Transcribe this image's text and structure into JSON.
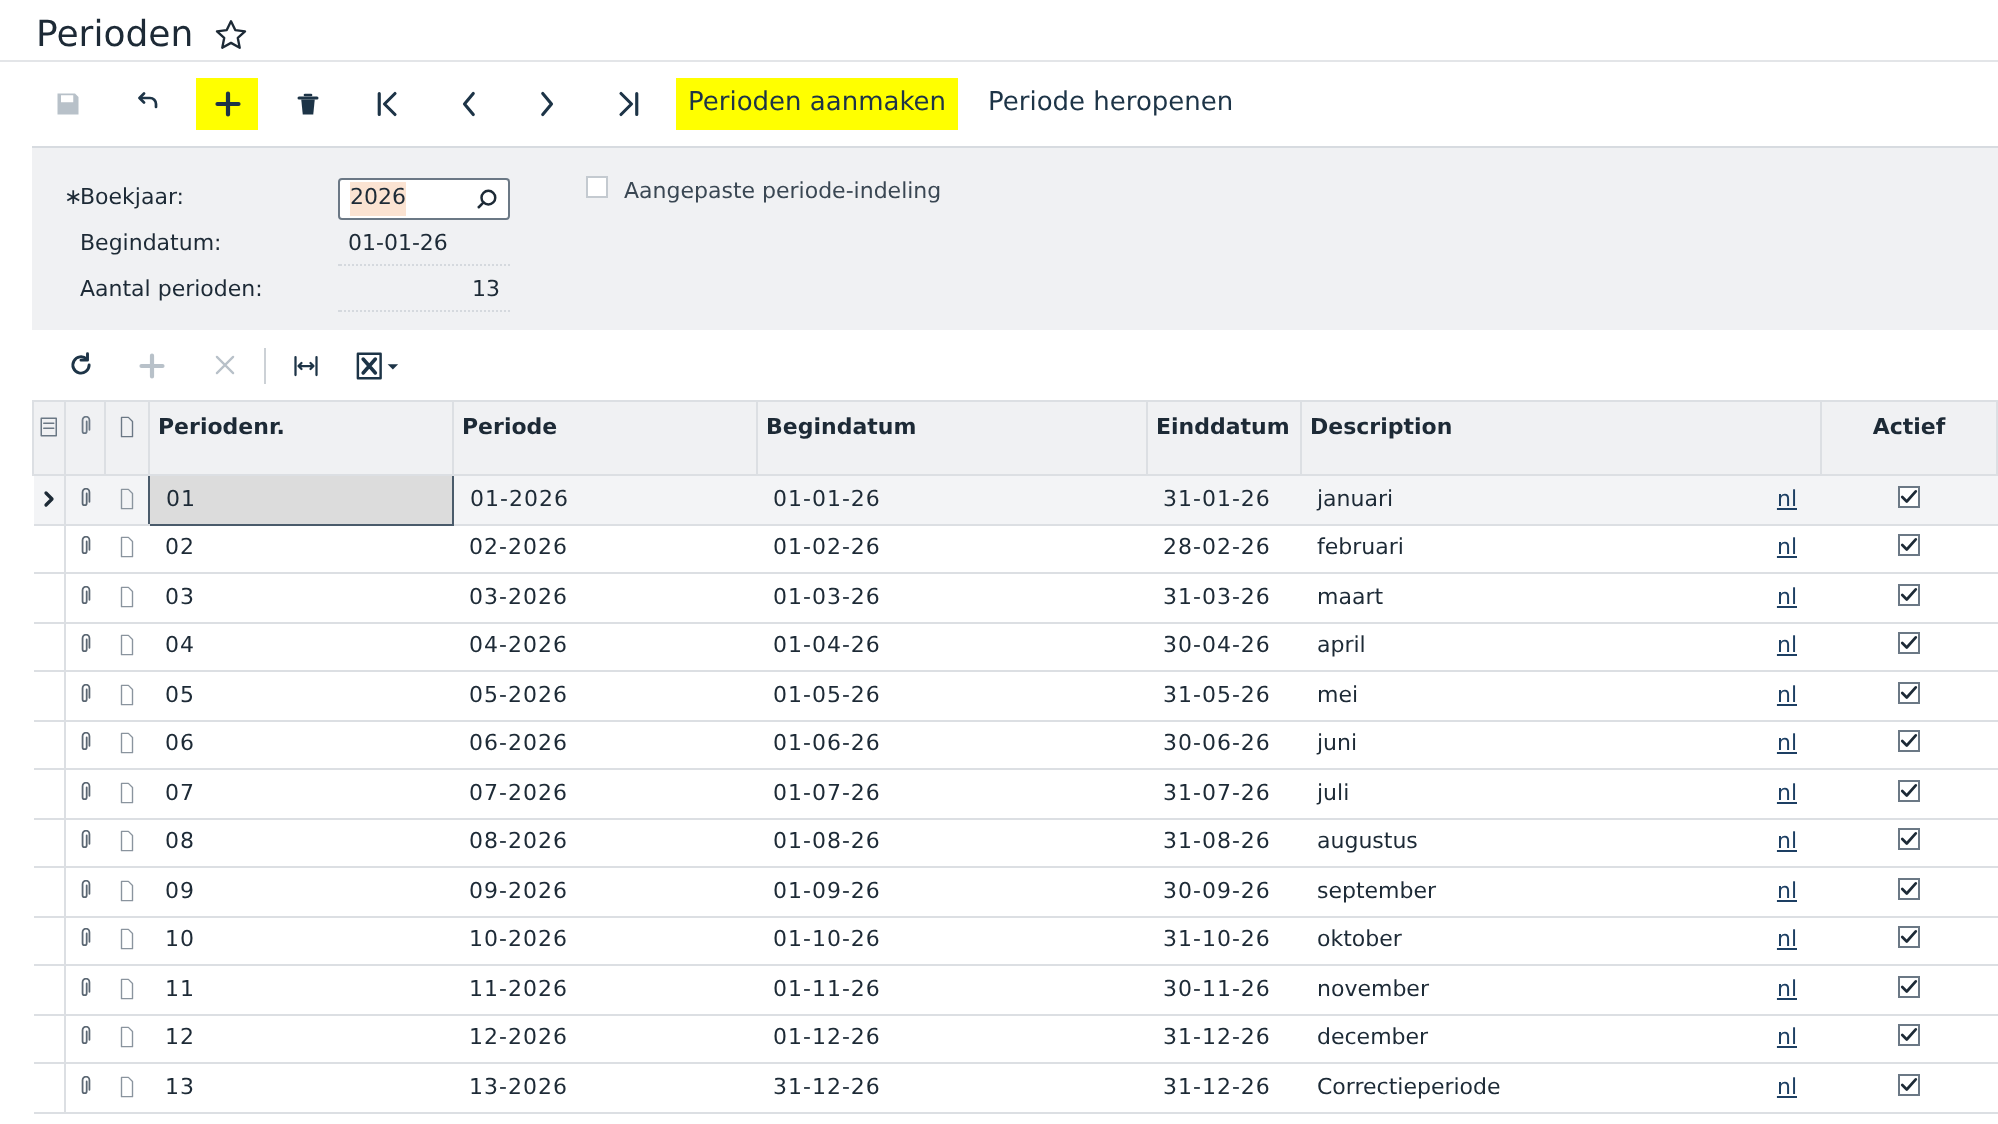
{
  "title": "Perioden",
  "toolbar": [
    {
      "kind": "save",
      "disabled": true,
      "highlighted": false
    },
    {
      "kind": "undo",
      "disabled": false,
      "highlighted": false
    },
    {
      "kind": "add",
      "disabled": false,
      "highlighted": true
    },
    {
      "kind": "delete",
      "disabled": false,
      "highlighted": false
    },
    {
      "kind": "first",
      "disabled": false,
      "highlighted": false
    },
    {
      "kind": "prev",
      "disabled": false,
      "highlighted": false
    },
    {
      "kind": "next",
      "disabled": false,
      "highlighted": false
    },
    {
      "kind": "last",
      "disabled": false,
      "highlighted": false
    },
    {
      "kind": "text",
      "label": "Perioden aanmaken",
      "disabled": false,
      "highlighted": true
    },
    {
      "kind": "text",
      "label": "Periode heropenen",
      "disabled": false,
      "highlighted": false
    }
  ],
  "form": {
    "fields": [
      {
        "label": "Boekjaar:",
        "required_mark": "∗",
        "kind": "lookup",
        "value": "2026"
      },
      {
        "label": "Begindatum:",
        "kind": "readonly",
        "value": "01-01-26"
      },
      {
        "label": "Aantal perioden:",
        "kind": "number",
        "value": "13"
      }
    ],
    "custom_split": {
      "label": "Aangepaste periode-indeling",
      "checked": false
    }
  },
  "grid_toolbar": [
    {
      "kind": "refresh",
      "disabled": false
    },
    {
      "kind": "add",
      "disabled": true
    },
    {
      "kind": "remove",
      "disabled": true
    },
    {
      "kind": "fit",
      "disabled": false
    },
    {
      "kind": "excel",
      "disabled": false
    }
  ],
  "table": {
    "columns": [
      "Periodenr.",
      "Periode",
      "Begindatum",
      "Einddatum",
      "Description",
      "Actief"
    ],
    "rows": [
      {
        "nr": "01",
        "periode": "01-2026",
        "begin": "01-01-26",
        "eind": "31-01-26",
        "description": "januari",
        "lang": "nl",
        "active": true,
        "selected": true
      },
      {
        "nr": "02",
        "periode": "02-2026",
        "begin": "01-02-26",
        "eind": "28-02-26",
        "description": "februari",
        "lang": "nl",
        "active": true,
        "selected": false
      },
      {
        "nr": "03",
        "periode": "03-2026",
        "begin": "01-03-26",
        "eind": "31-03-26",
        "description": "maart",
        "lang": "nl",
        "active": true,
        "selected": false
      },
      {
        "nr": "04",
        "periode": "04-2026",
        "begin": "01-04-26",
        "eind": "30-04-26",
        "description": "april",
        "lang": "nl",
        "active": true,
        "selected": false
      },
      {
        "nr": "05",
        "periode": "05-2026",
        "begin": "01-05-26",
        "eind": "31-05-26",
        "description": "mei",
        "lang": "nl",
        "active": true,
        "selected": false
      },
      {
        "nr": "06",
        "periode": "06-2026",
        "begin": "01-06-26",
        "eind": "30-06-26",
        "description": "juni",
        "lang": "nl",
        "active": true,
        "selected": false
      },
      {
        "nr": "07",
        "periode": "07-2026",
        "begin": "01-07-26",
        "eind": "31-07-26",
        "description": "juli",
        "lang": "nl",
        "active": true,
        "selected": false
      },
      {
        "nr": "08",
        "periode": "08-2026",
        "begin": "01-08-26",
        "eind": "31-08-26",
        "description": "augustus",
        "lang": "nl",
        "active": true,
        "selected": false
      },
      {
        "nr": "09",
        "periode": "09-2026",
        "begin": "01-09-26",
        "eind": "30-09-26",
        "description": "september",
        "lang": "nl",
        "active": true,
        "selected": false
      },
      {
        "nr": "10",
        "periode": "10-2026",
        "begin": "01-10-26",
        "eind": "31-10-26",
        "description": "oktober",
        "lang": "nl",
        "active": true,
        "selected": false
      },
      {
        "nr": "11",
        "periode": "11-2026",
        "begin": "01-11-26",
        "eind": "30-11-26",
        "description": "november",
        "lang": "nl",
        "active": true,
        "selected": false
      },
      {
        "nr": "12",
        "periode": "12-2026",
        "begin": "01-12-26",
        "eind": "31-12-26",
        "description": "december",
        "lang": "nl",
        "active": true,
        "selected": false
      },
      {
        "nr": "13",
        "periode": "13-2026",
        "begin": "31-12-26",
        "eind": "31-12-26",
        "description": "Correctieperiode",
        "lang": "nl",
        "active": true,
        "selected": false
      }
    ]
  }
}
